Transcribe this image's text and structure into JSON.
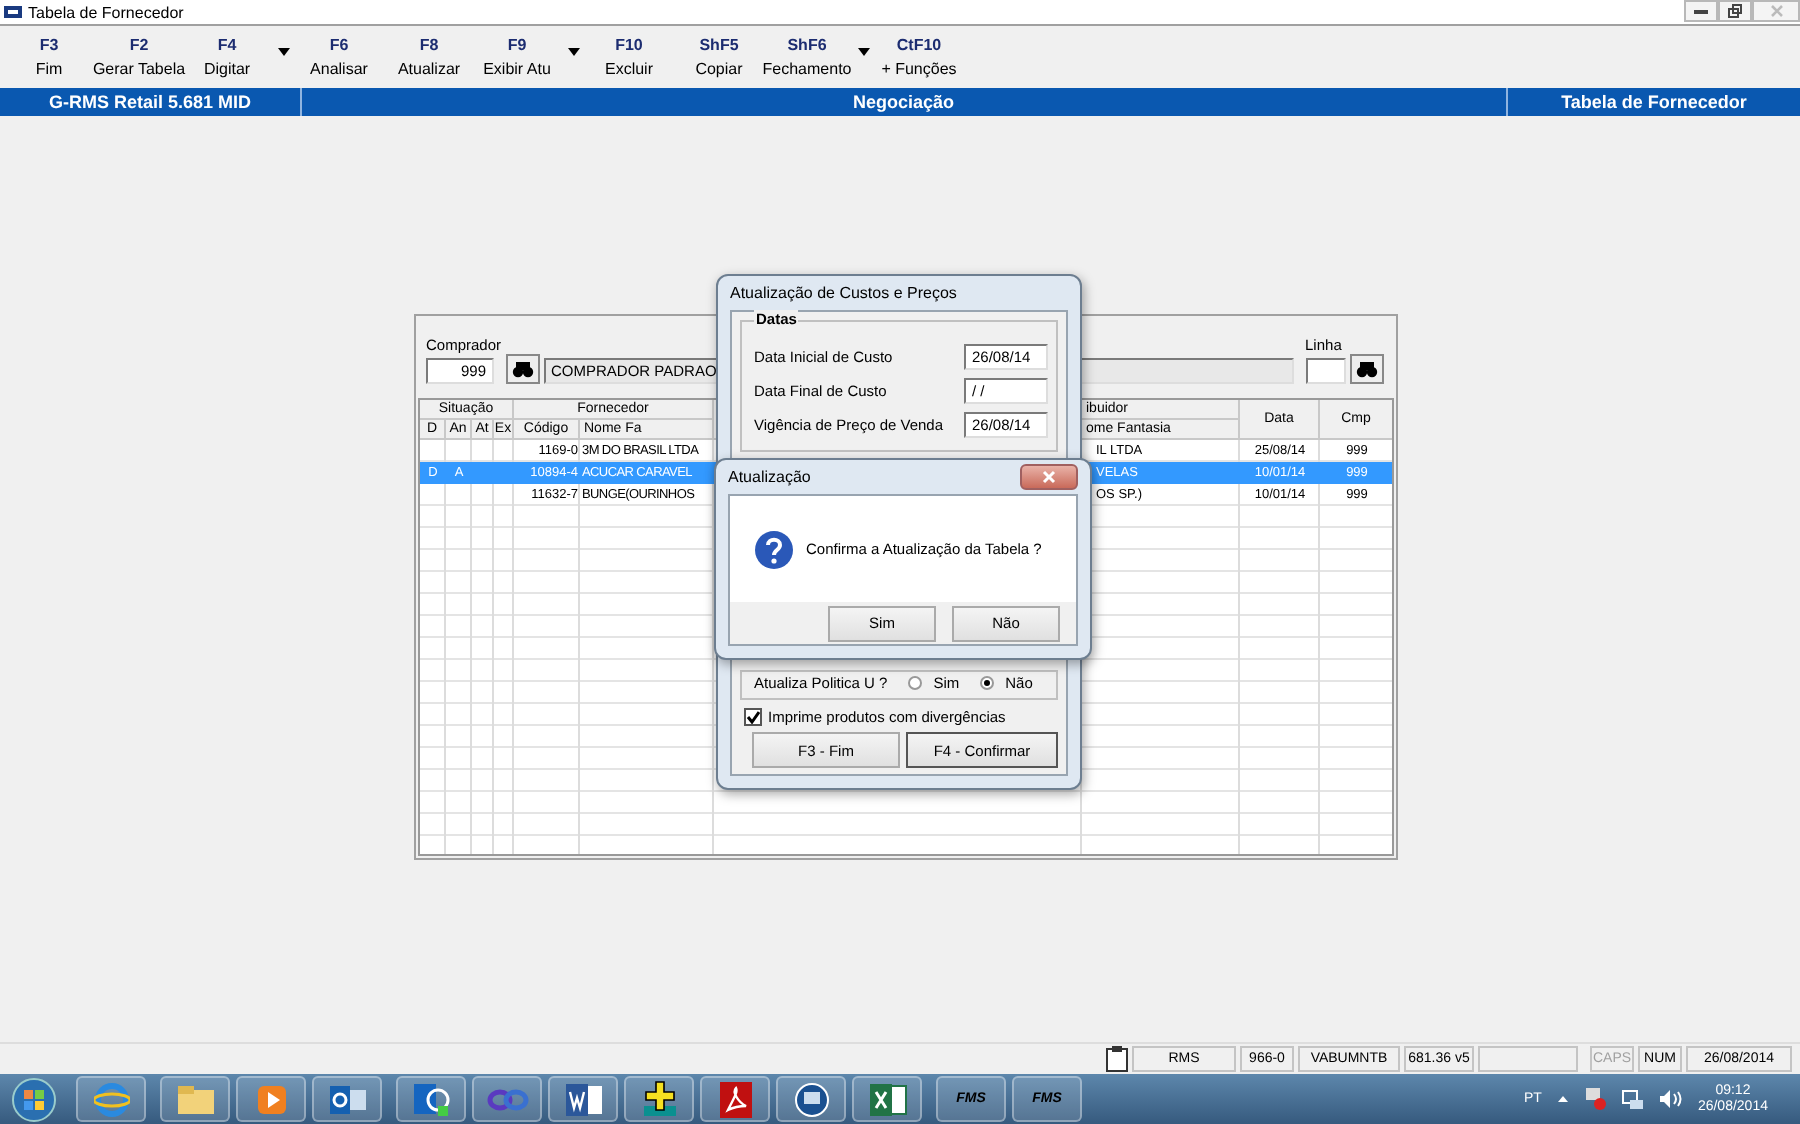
{
  "window": {
    "title": "Tabela de Fornecedor"
  },
  "toolbar": [
    {
      "key": "F3",
      "label": "Fim",
      "dropdown": false
    },
    {
      "key": "F2",
      "label": "Gerar Tabela",
      "dropdown": false
    },
    {
      "key": "F4",
      "label": "Digitar",
      "dropdown": true
    },
    {
      "key": "F6",
      "label": "Analisar",
      "dropdown": false
    },
    {
      "key": "F8",
      "label": "Atualizar",
      "dropdown": false
    },
    {
      "key": "F9",
      "label": "Exibir Atu",
      "dropdown": true
    },
    {
      "key": "F10",
      "label": "Excluir",
      "dropdown": false
    },
    {
      "key": "ShF5",
      "label": "Copiar",
      "dropdown": false
    },
    {
      "key": "ShF6",
      "label": "Fechamento",
      "dropdown": true
    },
    {
      "key": "CtF10",
      "label": "+ Funções",
      "dropdown": false
    }
  ],
  "header_bar": {
    "system": "G-RMS Retail 5.681 MID",
    "module": "Negociação",
    "screen": "Tabela de Fornecedor"
  },
  "filters": {
    "comprador_label": "Comprador",
    "comprador_code": "999",
    "comprador_name": "COMPRADOR PADRAO",
    "linha_label": "Linha"
  },
  "table": {
    "group_headers": {
      "situacao": "Situação",
      "fornecedor": "Fornecedor",
      "distribuidor": "ibuidor"
    },
    "columns": [
      "D",
      "An",
      "At",
      "Ex",
      "Código",
      "Nome Fa",
      "ome Fantasia",
      "Data",
      "Cmp"
    ],
    "rows": [
      {
        "selected": false,
        "codigo": "1169-0",
        "fornecedor": "3M DO BRASIL LTDA",
        "distribuidor": "IL LTDA",
        "data": "25/08/14",
        "cmp": "999"
      },
      {
        "selected": true,
        "d": "D",
        "an": "A",
        "codigo": "10894-4",
        "fornecedor": "ACUCAR CARAVEL",
        "distribuidor": "VELAS",
        "data": "10/01/14",
        "cmp": "999"
      },
      {
        "selected": false,
        "codigo": "11632-7",
        "fornecedor": "BUNGE(OURINHOS",
        "distribuidor": "OS SP.)",
        "data": "10/01/14",
        "cmp": "999"
      }
    ]
  },
  "dialog_custos": {
    "title": "Atualização de Custos e Preços",
    "group": "Datas",
    "fields": [
      {
        "label": "Data Inicial de Custo",
        "value": "26/08/14"
      },
      {
        "label": "Data Final de Custo",
        "value": "/ /"
      },
      {
        "label": "Vigência de Preço de Venda",
        "value": "26/08/14"
      }
    ],
    "politica": {
      "label": "Atualiza Politica U ?",
      "options": [
        {
          "label": "Sim",
          "selected": false
        },
        {
          "label": "Não",
          "selected": true
        }
      ]
    },
    "checkbox": {
      "label": "Imprime produtos com divergências",
      "checked": true
    },
    "buttons": [
      "F3 - Fim",
      "F4 - Confirmar"
    ]
  },
  "dialog_confirm": {
    "title": "Atualização",
    "message": "Confirma a Atualização da Tabela ?",
    "buttons": [
      "Sim",
      "Não"
    ]
  },
  "status_bar": {
    "panels": [
      "RMS",
      "966-0",
      "VABUMNTB",
      "681.36 v5"
    ],
    "indicators": [
      {
        "label": "CAPS",
        "on": false
      },
      {
        "label": "NUM",
        "on": true
      }
    ],
    "date": "26/08/2014"
  },
  "taskbar": {
    "apps": [
      {
        "kind": "browser"
      },
      {
        "kind": "folder"
      },
      {
        "kind": "media"
      },
      {
        "kind": "mail"
      },
      {
        "kind": "chat"
      },
      {
        "kind": "loop"
      },
      {
        "kind": "word"
      },
      {
        "kind": "plus"
      },
      {
        "kind": "pdf"
      },
      {
        "kind": "remote"
      },
      {
        "kind": "excel"
      },
      {
        "kind": "text",
        "label": "FMS"
      },
      {
        "kind": "text",
        "label": "FMS"
      }
    ],
    "tray": {
      "language": "PT",
      "time": "09:12",
      "date": "26/08/2014"
    }
  }
}
